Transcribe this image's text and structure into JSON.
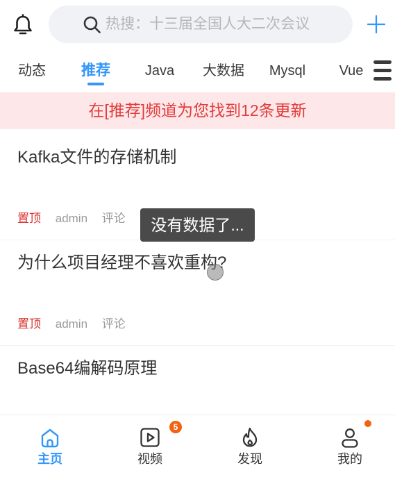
{
  "header": {
    "bell_icon": "bell-icon",
    "search": {
      "icon": "search-icon",
      "placeholder": "热搜：十三届全国人大二次会议"
    },
    "add_icon": "plus-icon"
  },
  "tabs": [
    {
      "label": "动态",
      "active": false
    },
    {
      "label": "推荐",
      "active": true
    },
    {
      "label": "Java",
      "active": false
    },
    {
      "label": "大数据",
      "active": false
    },
    {
      "label": "Mysql",
      "active": false
    },
    {
      "label": "Vue",
      "active": false
    }
  ],
  "tabs_menu_icon": "hamburger-menu-icon",
  "banner": {
    "text": "在[推荐]频道为您找到12条更新"
  },
  "articles": [
    {
      "title": "Kafka文件的存储机制",
      "tag": "置顶",
      "author": "admin",
      "comment_label": "评论"
    },
    {
      "title": "为什么项目经理不喜欢重构?",
      "tag": "置顶",
      "author": "admin",
      "comment_label": "评论"
    },
    {
      "title": "Base64编解码原理"
    }
  ],
  "toast": {
    "text": "没有数据了..."
  },
  "bottom_nav": [
    {
      "label": "主页",
      "icon": "home-icon",
      "active": true
    },
    {
      "label": "视频",
      "icon": "video-icon",
      "active": false,
      "badge": "5"
    },
    {
      "label": "发现",
      "icon": "fire-icon",
      "active": false
    },
    {
      "label": "我的",
      "icon": "user-icon",
      "active": false,
      "dot": true
    }
  ],
  "colors": {
    "accent": "#3296fa",
    "banner_text": "#e23c3c",
    "banner_bg": "#fde7e8",
    "pinned_tag": "#d9302c",
    "badge": "#f2620f",
    "toast_bg": "#4a4a4a"
  }
}
